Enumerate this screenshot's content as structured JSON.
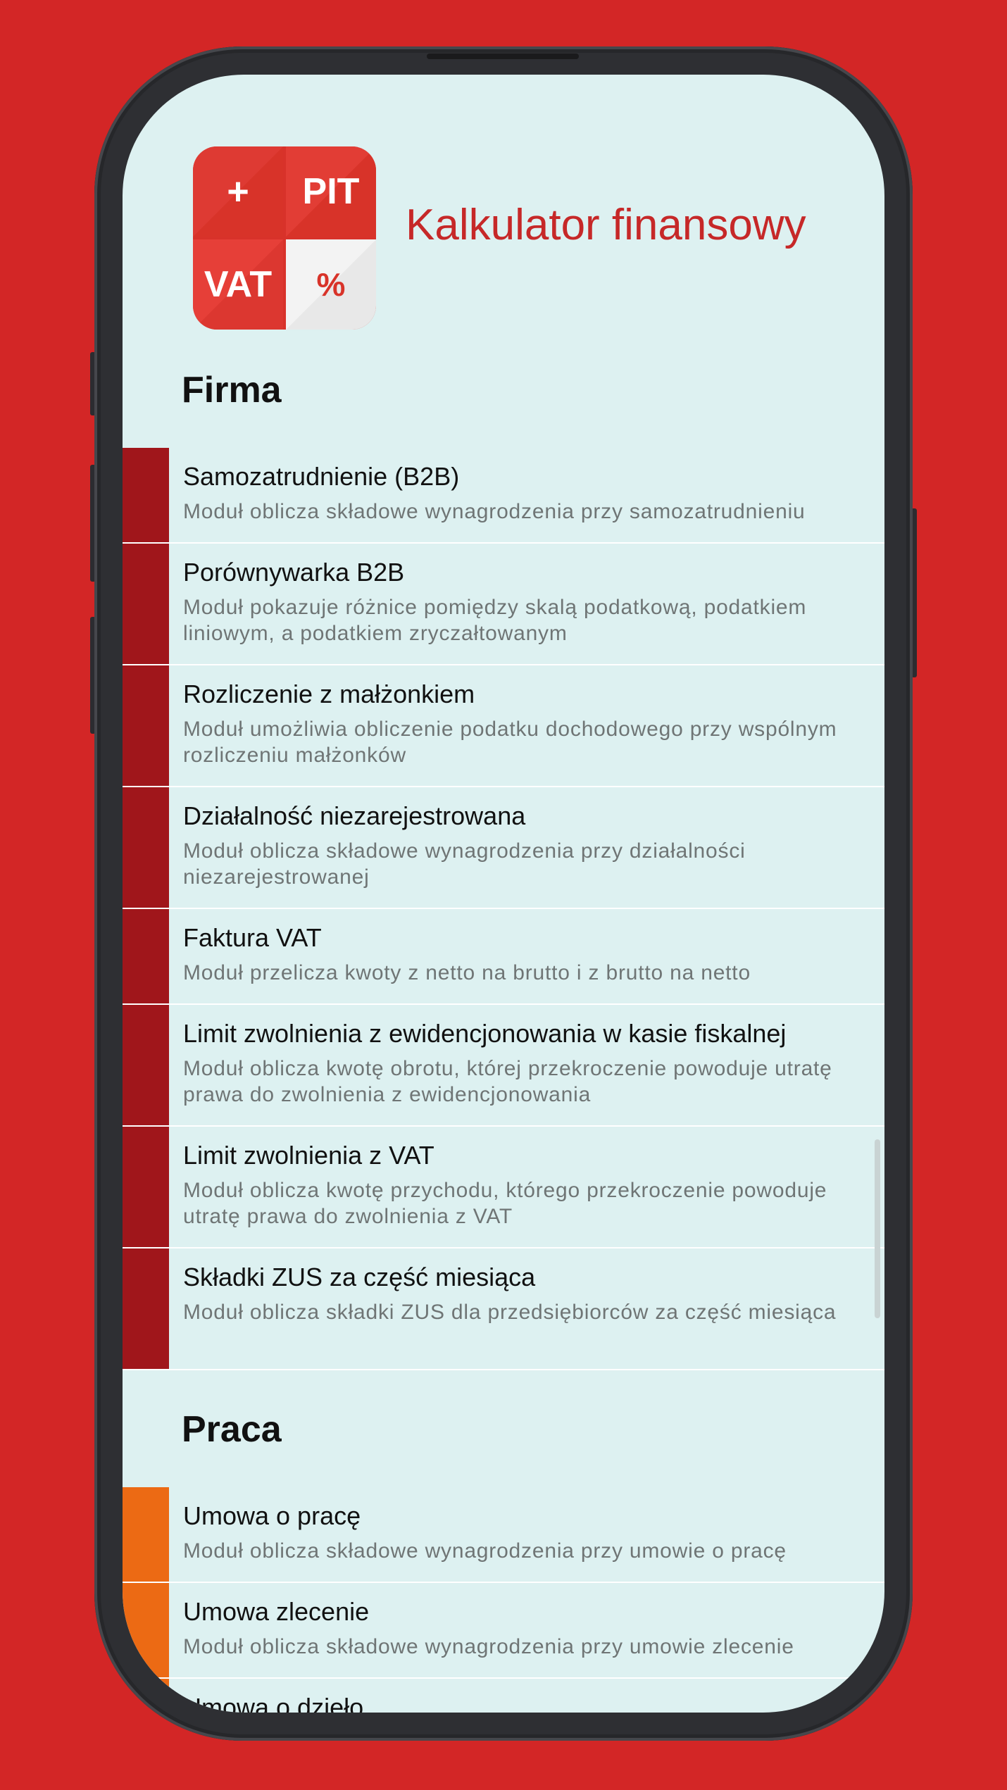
{
  "app": {
    "title": "Kalkulator finansowy",
    "logo": {
      "cell1": "+",
      "cell2": "PIT",
      "cell3": "VAT",
      "cell4": "%"
    }
  },
  "colors": {
    "background": "#d32626",
    "accent": "#c62828",
    "firma": "#a0161b",
    "praca": "#ec6a14",
    "screen": "#ddf1f1"
  },
  "sections": [
    {
      "title": "Firma",
      "items": [
        {
          "title": "Samozatrudnienie (B2B)",
          "desc": "Moduł oblicza składowe wynagrodzenia przy samozatrudnieniu"
        },
        {
          "title": "Porównywarka B2B",
          "desc": "Moduł pokazuje różnice pomiędzy skalą podatkową, podatkiem liniowym, a podatkiem zryczałtowanym"
        },
        {
          "title": "Rozliczenie z małżonkiem",
          "desc": "Moduł umożliwia obliczenie podatku dochodowego przy wspólnym rozliczeniu małżonków"
        },
        {
          "title": "Działalność niezarejestrowana",
          "desc": "Moduł oblicza składowe wynagrodzenia przy działalności niezarejestrowanej"
        },
        {
          "title": "Faktura VAT",
          "desc": "Moduł przelicza kwoty z netto na brutto i z brutto na netto"
        },
        {
          "title": "Limit zwolnienia z ewidencjonowania w kasie fiskalnej",
          "desc": "Moduł oblicza kwotę obrotu, której przekroczenie powoduje utratę prawa do zwolnienia z ewidencjonowania"
        },
        {
          "title": "Limit zwolnienia z VAT",
          "desc": "Moduł oblicza kwotę przychodu, którego przekroczenie powoduje utratę prawa do zwolnienia z VAT"
        },
        {
          "title": "Składki ZUS za część miesiąca",
          "desc": "Moduł oblicza składki ZUS dla przedsiębiorców za część miesiąca"
        }
      ]
    },
    {
      "title": "Praca",
      "items": [
        {
          "title": "Umowa o pracę",
          "desc": "Moduł oblicza składowe wynagrodzenia przy umowie o pracę"
        },
        {
          "title": "Umowa zlecenie",
          "desc": "Moduł oblicza składowe wynagrodzenia przy umowie zlecenie"
        },
        {
          "title": "Umowa o dzieło",
          "desc": ""
        }
      ]
    }
  ]
}
